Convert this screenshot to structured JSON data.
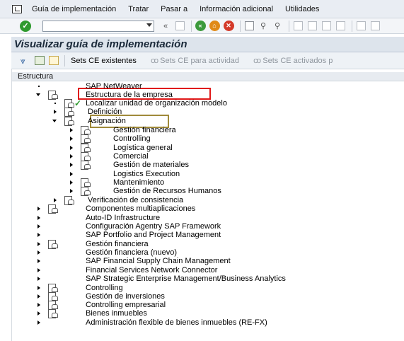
{
  "menubar": {
    "items": [
      {
        "label": "Guía de implementación"
      },
      {
        "label": "Tratar"
      },
      {
        "label": "Pasar a"
      },
      {
        "label": "Información adicional"
      },
      {
        "label": "Utilidades"
      }
    ]
  },
  "toolbar": {
    "command_value": "",
    "back_label": "«"
  },
  "title": "Visualizar guía de implementación",
  "app_toolbar": {
    "sets_ce_existentes": "Sets CE existentes",
    "sets_ce_actividad": "Sets CE para actividad",
    "sets_ce_activados": "Sets CE activados p"
  },
  "tree": {
    "header": "Estructura",
    "nodes": [
      {
        "label": "SAP NetWeaver"
      },
      {
        "label": "Estructura de la empresa"
      },
      {
        "label": "Localizar unidad de organización modelo"
      },
      {
        "label": "Definición"
      },
      {
        "label": "Asignación"
      },
      {
        "label": "Gestión financiera"
      },
      {
        "label": "Controlling"
      },
      {
        "label": "Logística general"
      },
      {
        "label": "Comercial"
      },
      {
        "label": "Gestión de materiales"
      },
      {
        "label": "Logistics Execution"
      },
      {
        "label": "Mantenimiento"
      },
      {
        "label": "Gestión de Recursos Humanos"
      },
      {
        "label": "Verificación de consistencia"
      },
      {
        "label": "Componentes multiaplicaciones"
      },
      {
        "label": "Auto-ID Infrastructure"
      },
      {
        "label": "Configuración Agentry SAP Framework"
      },
      {
        "label": "SAP Portfolio and Project Management"
      },
      {
        "label": "Gestión financiera"
      },
      {
        "label": "Gestión financiera (nuevo)"
      },
      {
        "label": "SAP Financial Supply Chain Management"
      },
      {
        "label": "Financial Services Network Connector"
      },
      {
        "label": "SAP Strategic Enterprise Management/Business Analytics"
      },
      {
        "label": "Controlling"
      },
      {
        "label": "Gestión de inversiones"
      },
      {
        "label": "Controlling empresarial"
      },
      {
        "label": "Bienes inmuebles"
      },
      {
        "label": "Administración flexible de bienes inmuebles (RE-FX)"
      }
    ]
  },
  "colors": {
    "highlight_red": "#e01818",
    "highlight_olive": "#a08a3a"
  }
}
